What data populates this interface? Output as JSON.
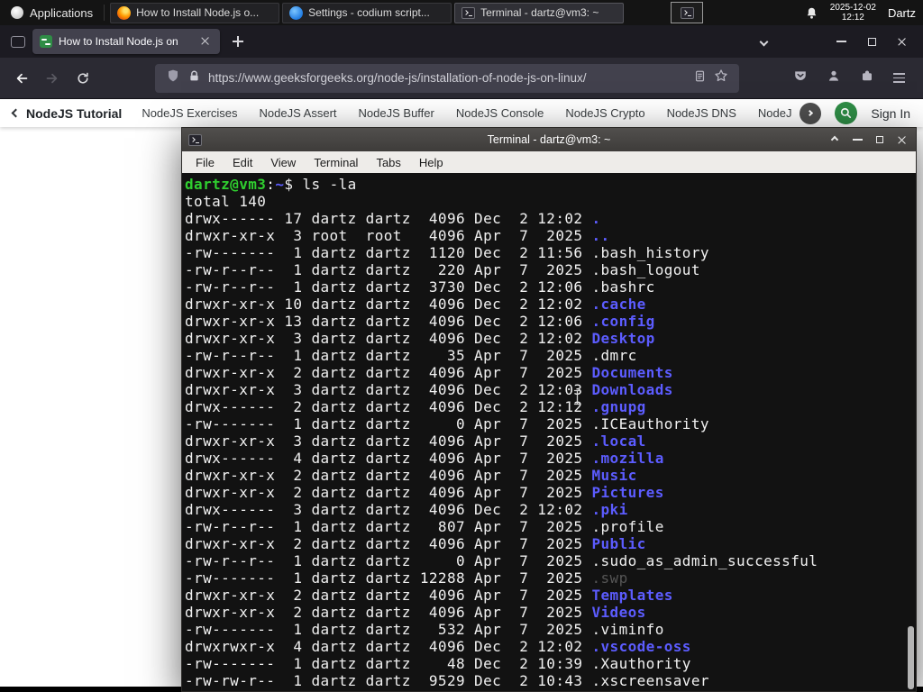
{
  "colors": {
    "accent_green": "#2f8d46",
    "dir_blue": "#5c5cff",
    "prompt_green": "#2fce2f",
    "dim_gray": "#555555"
  },
  "panel": {
    "applications_label": "Applications",
    "windows": [
      {
        "title": "How to Install Node.js o...",
        "icon": "firefox",
        "active": false
      },
      {
        "title": "Settings - codium script...",
        "icon": "settings",
        "active": false
      },
      {
        "title": "Terminal - dartz@vm3: ~",
        "icon": "terminal",
        "active": true
      }
    ],
    "clock_date": "2025-12-02",
    "clock_time": "12:12",
    "user_label": "Dartz"
  },
  "browser": {
    "tab_title": "How to Install Node.js on",
    "url": "https://www.geeksforgeeks.org/node-js/installation-of-node-js-on-linux/"
  },
  "site_nav": {
    "back_label": "NodeJS Tutorial",
    "links": [
      "NodeJS Exercises",
      "NodeJS Assert",
      "NodeJS Buffer",
      "NodeJS Console",
      "NodeJS Crypto",
      "NodeJS DNS",
      "NodeJS"
    ],
    "sign_in_label": "Sign In"
  },
  "terminal": {
    "title": "Terminal - dartz@vm3: ~",
    "menus": [
      "File",
      "Edit",
      "View",
      "Terminal",
      "Tabs",
      "Help"
    ],
    "prompt_user": "dartz@vm3",
    "prompt_colon": ":",
    "prompt_path": "~",
    "prompt_dollar": "$ ",
    "command": "ls -la",
    "total_line": "total 140",
    "listing": [
      {
        "pre": "drwx------ 17 dartz dartz  4096 Dec  2 12:02 ",
        "name": ".",
        "type": "dir"
      },
      {
        "pre": "drwxr-xr-x  3 root  root   4096 Apr  7  2025 ",
        "name": "..",
        "type": "dir"
      },
      {
        "pre": "-rw-------  1 dartz dartz  1120 Dec  2 11:56 ",
        "name": ".bash_history",
        "type": "file"
      },
      {
        "pre": "-rw-r--r--  1 dartz dartz   220 Apr  7  2025 ",
        "name": ".bash_logout",
        "type": "file"
      },
      {
        "pre": "-rw-r--r--  1 dartz dartz  3730 Dec  2 12:06 ",
        "name": ".bashrc",
        "type": "file"
      },
      {
        "pre": "drwxr-xr-x 10 dartz dartz  4096 Dec  2 12:02 ",
        "name": ".cache",
        "type": "dir"
      },
      {
        "pre": "drwxr-xr-x 13 dartz dartz  4096 Dec  2 12:06 ",
        "name": ".config",
        "type": "dir"
      },
      {
        "pre": "drwxr-xr-x  3 dartz dartz  4096 Dec  2 12:02 ",
        "name": "Desktop",
        "type": "dir"
      },
      {
        "pre": "-rw-r--r--  1 dartz dartz    35 Apr  7  2025 ",
        "name": ".dmrc",
        "type": "file"
      },
      {
        "pre": "drwxr-xr-x  2 dartz dartz  4096 Apr  7  2025 ",
        "name": "Documents",
        "type": "dir"
      },
      {
        "pre": "drwxr-xr-x  3 dartz dartz  4096 Dec  2 12:03 ",
        "name": "Downloads",
        "type": "dir"
      },
      {
        "pre": "drwx------  2 dartz dartz  4096 Dec  2 12:12 ",
        "name": ".gnupg",
        "type": "dir"
      },
      {
        "pre": "-rw-------  1 dartz dartz     0 Apr  7  2025 ",
        "name": ".ICEauthority",
        "type": "file"
      },
      {
        "pre": "drwxr-xr-x  3 dartz dartz  4096 Apr  7  2025 ",
        "name": ".local",
        "type": "dir"
      },
      {
        "pre": "drwx------  4 dartz dartz  4096 Apr  7  2025 ",
        "name": ".mozilla",
        "type": "dir"
      },
      {
        "pre": "drwxr-xr-x  2 dartz dartz  4096 Apr  7  2025 ",
        "name": "Music",
        "type": "dir"
      },
      {
        "pre": "drwxr-xr-x  2 dartz dartz  4096 Apr  7  2025 ",
        "name": "Pictures",
        "type": "dir"
      },
      {
        "pre": "drwx------  3 dartz dartz  4096 Dec  2 12:02 ",
        "name": ".pki",
        "type": "dir"
      },
      {
        "pre": "-rw-r--r--  1 dartz dartz   807 Apr  7  2025 ",
        "name": ".profile",
        "type": "file"
      },
      {
        "pre": "drwxr-xr-x  2 dartz dartz  4096 Apr  7  2025 ",
        "name": "Public",
        "type": "dir"
      },
      {
        "pre": "-rw-r--r--  1 dartz dartz     0 Apr  7  2025 ",
        "name": ".sudo_as_admin_successful",
        "type": "file"
      },
      {
        "pre": "-rw-------  1 dartz dartz 12288 Apr  7  2025 ",
        "name": ".swp",
        "type": "dim"
      },
      {
        "pre": "drwxr-xr-x  2 dartz dartz  4096 Apr  7  2025 ",
        "name": "Templates",
        "type": "dir"
      },
      {
        "pre": "drwxr-xr-x  2 dartz dartz  4096 Apr  7  2025 ",
        "name": "Videos",
        "type": "dir"
      },
      {
        "pre": "-rw-------  1 dartz dartz   532 Apr  7  2025 ",
        "name": ".viminfo",
        "type": "file"
      },
      {
        "pre": "drwxrwxr-x  4 dartz dartz  4096 Dec  2 12:02 ",
        "name": ".vscode-oss",
        "type": "dir"
      },
      {
        "pre": "-rw-------  1 dartz dartz    48 Dec  2 10:39 ",
        "name": ".Xauthority",
        "type": "file"
      },
      {
        "pre": "-rw-rw-r--  1 dartz dartz  9529 Dec  2 10:43 ",
        "name": ".xscreensaver",
        "type": "file"
      }
    ]
  }
}
